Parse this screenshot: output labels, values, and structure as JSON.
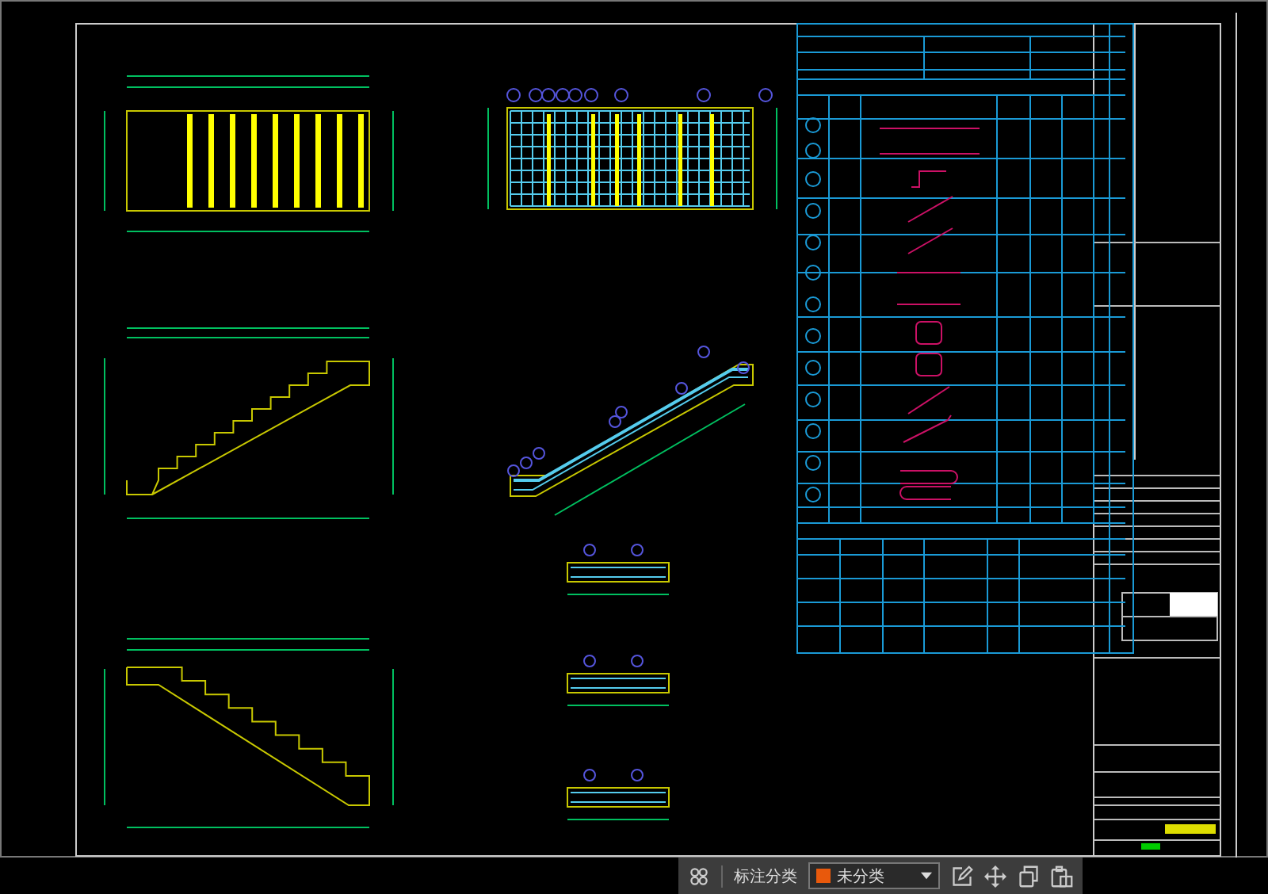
{
  "toolbar": {
    "label": "标注分类",
    "category": {
      "name": "未分类",
      "color": "#e8590c"
    }
  }
}
